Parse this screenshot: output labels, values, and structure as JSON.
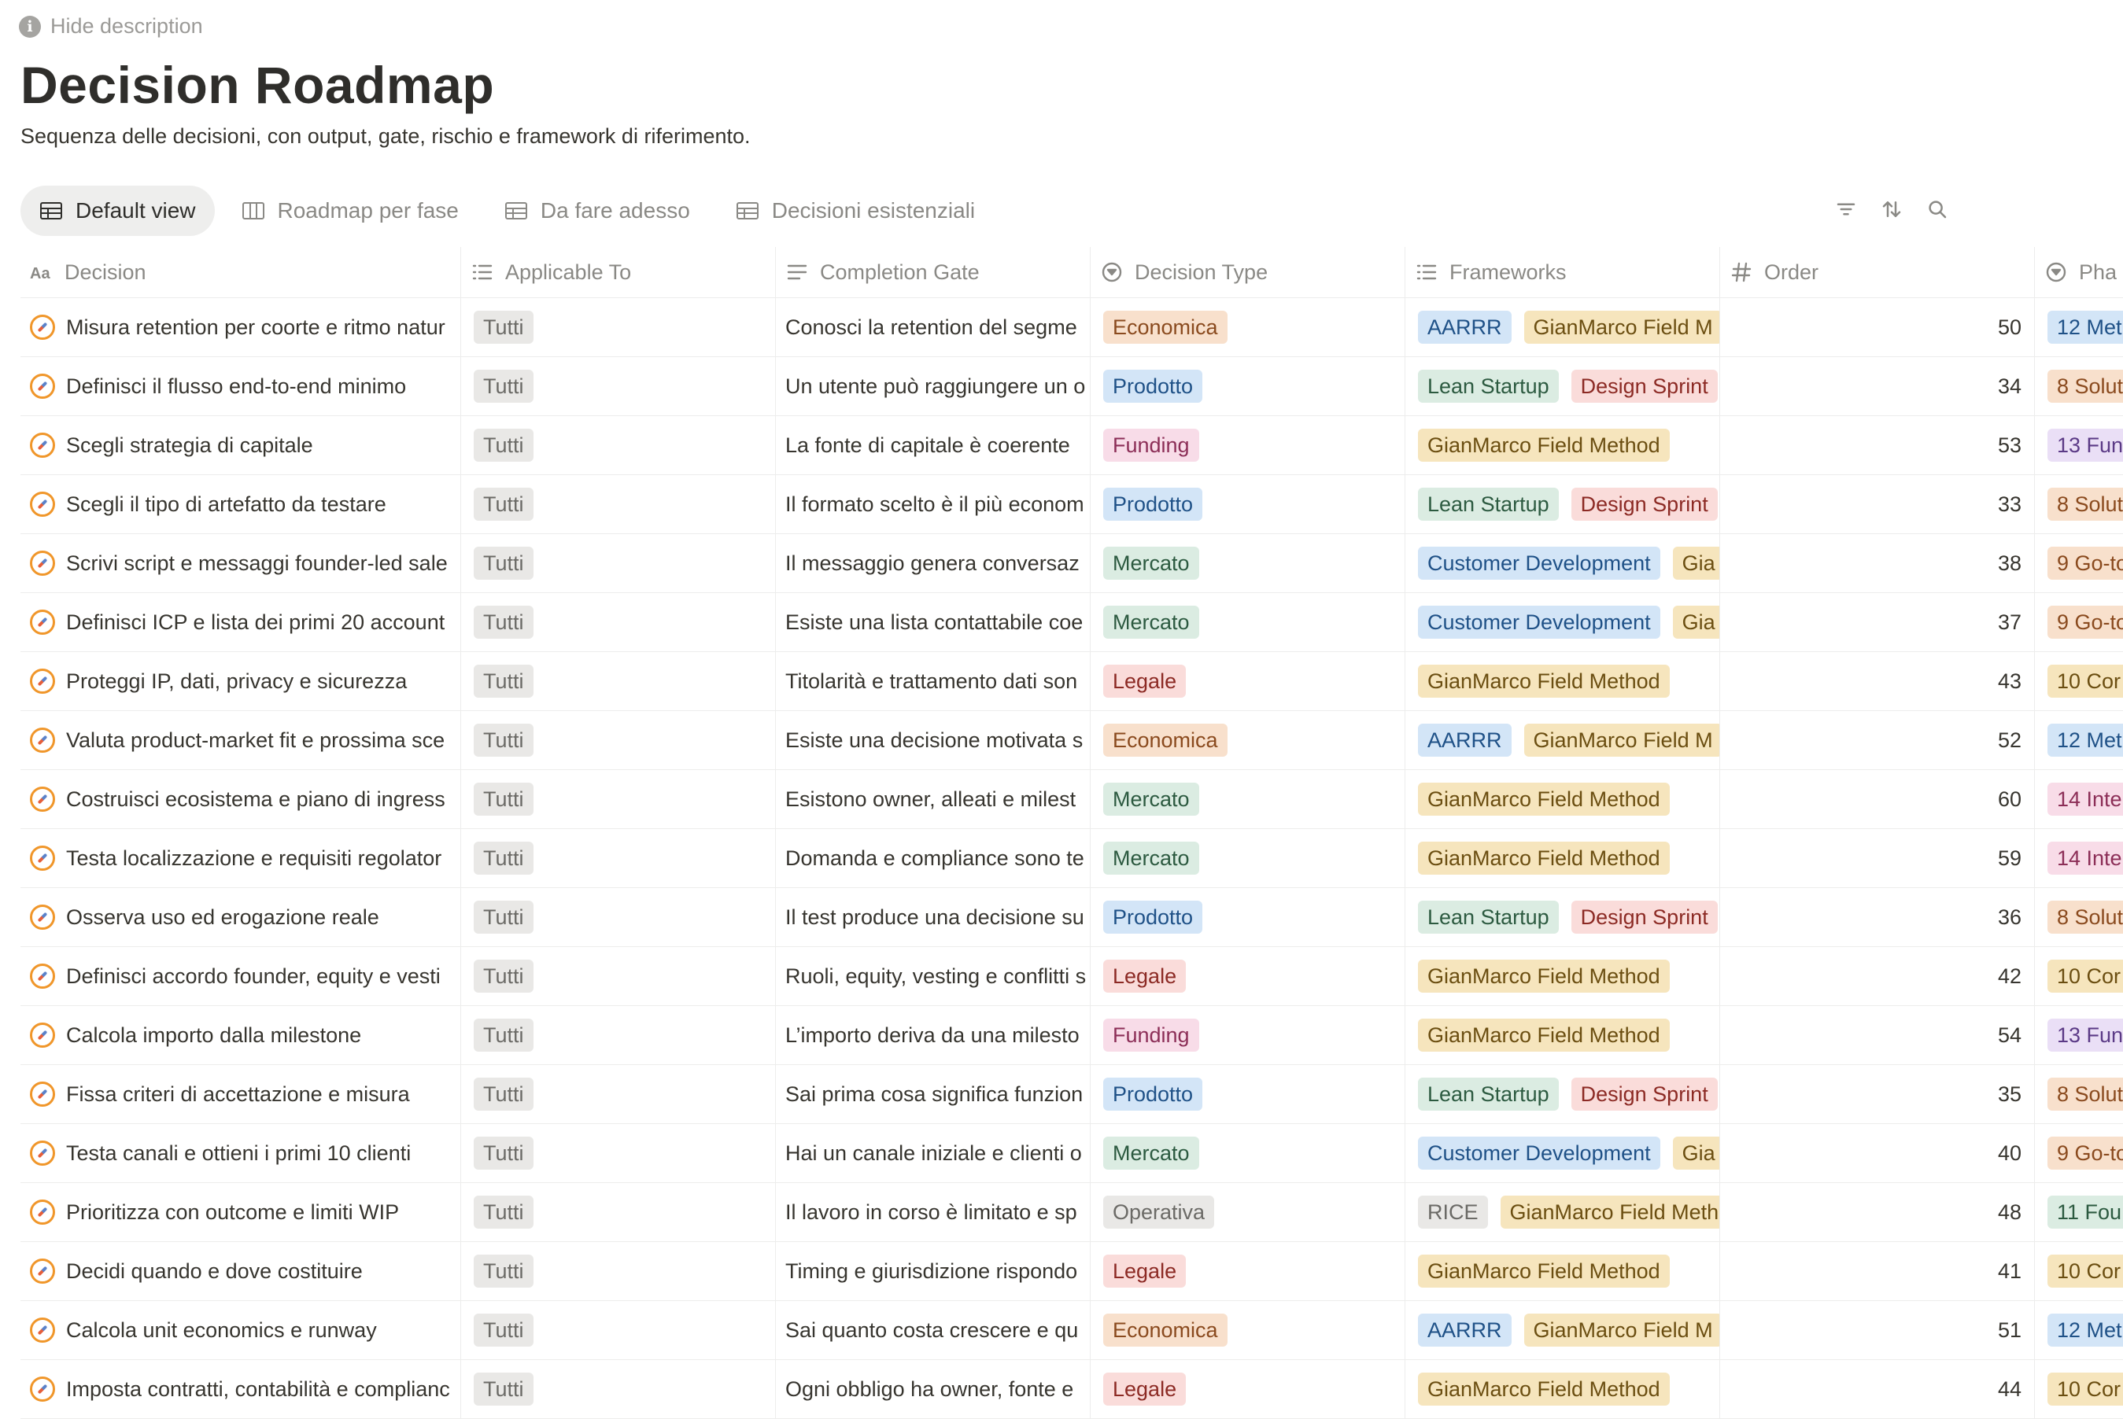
{
  "description_toggle": "Hide description",
  "title": "Decision Roadmap",
  "subtitle": "Sequenza delle decisioni, con output, gate, rischio e framework di riferimento.",
  "views": [
    {
      "label": "Default view",
      "icon": "table-icon",
      "active": true
    },
    {
      "label": "Roadmap per fase",
      "icon": "board-icon",
      "active": false
    },
    {
      "label": "Da fare adesso",
      "icon": "table-icon",
      "active": false
    },
    {
      "label": "Decisioni esistenziali",
      "icon": "table-icon",
      "active": false
    }
  ],
  "toolbar": [
    "filter-icon",
    "sort-icon",
    "search-icon"
  ],
  "columns": [
    {
      "label": "Decision",
      "icon": "title-icon"
    },
    {
      "label": "Applicable To",
      "icon": "list-icon"
    },
    {
      "label": "Completion Gate",
      "icon": "text-icon"
    },
    {
      "label": "Decision Type",
      "icon": "select-icon"
    },
    {
      "label": "Frameworks",
      "icon": "list-icon"
    },
    {
      "label": "Order",
      "icon": "number-icon"
    },
    {
      "label": "Pha",
      "icon": "select-icon"
    }
  ],
  "tag_colors": {
    "gray": "#e9e8e6",
    "orange": "#f8e0cc",
    "blue": "#d3e5f7",
    "pink": "#f8dce8",
    "green": "#dbece2",
    "red": "#fadcda",
    "yellow": "#f6e5bd",
    "purple": "#eadff6"
  },
  "rows": [
    {
      "decision": "Misura retention per coorte e ritmo natur",
      "applicable": "Tutti",
      "gate": "Conosci la retention del segme",
      "type": {
        "label": "Economica",
        "color": "orange"
      },
      "frameworks": [
        {
          "label": "AARRR",
          "color": "blue"
        },
        {
          "label": "GianMarco Field M",
          "color": "yellow"
        }
      ],
      "order": "50",
      "phase": {
        "label": "12 Met",
        "color": "blue"
      }
    },
    {
      "decision": "Definisci il flusso end-to-end minimo",
      "applicable": "Tutti",
      "gate": "Un utente può raggiungere un o",
      "type": {
        "label": "Prodotto",
        "color": "blue"
      },
      "frameworks": [
        {
          "label": "Lean Startup",
          "color": "green"
        },
        {
          "label": "Design Sprint",
          "color": "red"
        }
      ],
      "order": "34",
      "phase": {
        "label": "8 Solut",
        "color": "orange"
      }
    },
    {
      "decision": "Scegli strategia di capitale",
      "applicable": "Tutti",
      "gate": "La fonte di capitale è coerente",
      "type": {
        "label": "Funding",
        "color": "pink"
      },
      "frameworks": [
        {
          "label": "GianMarco Field Method",
          "color": "yellow"
        }
      ],
      "order": "53",
      "phase": {
        "label": "13 Fun",
        "color": "purple"
      }
    },
    {
      "decision": "Scegli il tipo di artefatto da testare",
      "applicable": "Tutti",
      "gate": "Il formato scelto è il più econom",
      "type": {
        "label": "Prodotto",
        "color": "blue"
      },
      "frameworks": [
        {
          "label": "Lean Startup",
          "color": "green"
        },
        {
          "label": "Design Sprint",
          "color": "red"
        }
      ],
      "order": "33",
      "phase": {
        "label": "8 Solut",
        "color": "orange"
      }
    },
    {
      "decision": "Scrivi script e messaggi founder-led sale",
      "applicable": "Tutti",
      "gate": "Il messaggio genera conversaz",
      "type": {
        "label": "Mercato",
        "color": "green"
      },
      "frameworks": [
        {
          "label": "Customer Development",
          "color": "blue"
        },
        {
          "label": "Gia",
          "color": "yellow"
        }
      ],
      "order": "38",
      "phase": {
        "label": "9 Go-to",
        "color": "orange"
      }
    },
    {
      "decision": "Definisci ICP e lista dei primi 20 account",
      "applicable": "Tutti",
      "gate": "Esiste una lista contattabile coe",
      "type": {
        "label": "Mercato",
        "color": "green"
      },
      "frameworks": [
        {
          "label": "Customer Development",
          "color": "blue"
        },
        {
          "label": "Gia",
          "color": "yellow"
        }
      ],
      "order": "37",
      "phase": {
        "label": "9 Go-to",
        "color": "orange"
      }
    },
    {
      "decision": "Proteggi IP, dati, privacy e sicurezza",
      "applicable": "Tutti",
      "gate": "Titolarità e trattamento dati son",
      "type": {
        "label": "Legale",
        "color": "red"
      },
      "frameworks": [
        {
          "label": "GianMarco Field Method",
          "color": "yellow"
        }
      ],
      "order": "43",
      "phase": {
        "label": "10 Cor",
        "color": "yellow"
      }
    },
    {
      "decision": "Valuta product-market fit e prossima sce",
      "applicable": "Tutti",
      "gate": "Esiste una decisione motivata s",
      "type": {
        "label": "Economica",
        "color": "orange"
      },
      "frameworks": [
        {
          "label": "AARRR",
          "color": "blue"
        },
        {
          "label": "GianMarco Field M",
          "color": "yellow"
        }
      ],
      "order": "52",
      "phase": {
        "label": "12 Met",
        "color": "blue"
      }
    },
    {
      "decision": "Costruisci ecosistema e piano di ingress",
      "applicable": "Tutti",
      "gate": "Esistono owner, alleati e milest",
      "type": {
        "label": "Mercato",
        "color": "green"
      },
      "frameworks": [
        {
          "label": "GianMarco Field Method",
          "color": "yellow"
        }
      ],
      "order": "60",
      "phase": {
        "label": "14 Inte",
        "color": "pink"
      }
    },
    {
      "decision": "Testa localizzazione e requisiti regolator",
      "applicable": "Tutti",
      "gate": "Domanda e compliance sono te",
      "type": {
        "label": "Mercato",
        "color": "green"
      },
      "frameworks": [
        {
          "label": "GianMarco Field Method",
          "color": "yellow"
        }
      ],
      "order": "59",
      "phase": {
        "label": "14 Inte",
        "color": "pink"
      }
    },
    {
      "decision": "Osserva uso ed erogazione reale",
      "applicable": "Tutti",
      "gate": "Il test produce una decisione su",
      "type": {
        "label": "Prodotto",
        "color": "blue"
      },
      "frameworks": [
        {
          "label": "Lean Startup",
          "color": "green"
        },
        {
          "label": "Design Sprint",
          "color": "red"
        }
      ],
      "order": "36",
      "phase": {
        "label": "8 Solut",
        "color": "orange"
      }
    },
    {
      "decision": "Definisci accordo founder, equity e vesti",
      "applicable": "Tutti",
      "gate": "Ruoli, equity, vesting e conflitti s",
      "type": {
        "label": "Legale",
        "color": "red"
      },
      "frameworks": [
        {
          "label": "GianMarco Field Method",
          "color": "yellow"
        }
      ],
      "order": "42",
      "phase": {
        "label": "10 Cor",
        "color": "yellow"
      }
    },
    {
      "decision": "Calcola importo dalla milestone",
      "applicable": "Tutti",
      "gate": "L’importo deriva da una milesto",
      "type": {
        "label": "Funding",
        "color": "pink"
      },
      "frameworks": [
        {
          "label": "GianMarco Field Method",
          "color": "yellow"
        }
      ],
      "order": "54",
      "phase": {
        "label": "13 Fun",
        "color": "purple"
      }
    },
    {
      "decision": "Fissa criteri di accettazione e misura",
      "applicable": "Tutti",
      "gate": "Sai prima cosa significa funzion",
      "type": {
        "label": "Prodotto",
        "color": "blue"
      },
      "frameworks": [
        {
          "label": "Lean Startup",
          "color": "green"
        },
        {
          "label": "Design Sprint",
          "color": "red"
        }
      ],
      "order": "35",
      "phase": {
        "label": "8 Solut",
        "color": "orange"
      }
    },
    {
      "decision": "Testa canali e ottieni i primi 10 clienti",
      "applicable": "Tutti",
      "gate": "Hai un canale iniziale e clienti o",
      "type": {
        "label": "Mercato",
        "color": "green"
      },
      "frameworks": [
        {
          "label": "Customer Development",
          "color": "blue"
        },
        {
          "label": "Gia",
          "color": "yellow"
        }
      ],
      "order": "40",
      "phase": {
        "label": "9 Go-to",
        "color": "orange"
      }
    },
    {
      "decision": "Prioritizza con outcome e limiti WIP",
      "applicable": "Tutti",
      "gate": "Il lavoro in corso è limitato e sp",
      "type": {
        "label": "Operativa",
        "color": "gray"
      },
      "frameworks": [
        {
          "label": "RICE",
          "color": "gray"
        },
        {
          "label": "GianMarco Field Meth",
          "color": "yellow"
        }
      ],
      "order": "48",
      "phase": {
        "label": "11 Fou",
        "color": "green"
      }
    },
    {
      "decision": "Decidi quando e dove costituire",
      "applicable": "Tutti",
      "gate": "Timing e giurisdizione rispondo",
      "type": {
        "label": "Legale",
        "color": "red"
      },
      "frameworks": [
        {
          "label": "GianMarco Field Method",
          "color": "yellow"
        }
      ],
      "order": "41",
      "phase": {
        "label": "10 Cor",
        "color": "yellow"
      }
    },
    {
      "decision": "Calcola unit economics e runway",
      "applicable": "Tutti",
      "gate": "Sai quanto costa crescere e qu",
      "type": {
        "label": "Economica",
        "color": "orange"
      },
      "frameworks": [
        {
          "label": "AARRR",
          "color": "blue"
        },
        {
          "label": "GianMarco Field M",
          "color": "yellow"
        }
      ],
      "order": "51",
      "phase": {
        "label": "12 Met",
        "color": "blue"
      }
    },
    {
      "decision": "Imposta contratti, contabilità e complianc",
      "applicable": "Tutti",
      "gate": "Ogni obbligo ha owner, fonte e",
      "type": {
        "label": "Legale",
        "color": "red"
      },
      "frameworks": [
        {
          "label": "GianMarco Field Method",
          "color": "yellow"
        }
      ],
      "order": "44",
      "phase": {
        "label": "10 Cor",
        "color": "yellow"
      }
    }
  ]
}
